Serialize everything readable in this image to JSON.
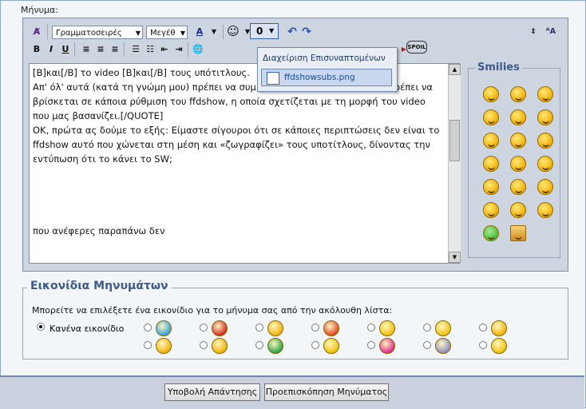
{
  "message_label": "Μήνυμα:",
  "toolbar": {
    "font_select": "Γραμματοσειρές",
    "size_select": "Μεγέθ",
    "attach_label": "0"
  },
  "editor_text": [
    "[B]και[/B] το video [B]και[/B] τους υπότιτλους.",
    "Απ' όλ' αυτά (κατά τη γνώμη μου) πρέπει να συμ",
    "πρέπει να",
    "βρίσκεται σε κάποια ρύθμιση του ffdshow, η οποία σχετίζεται με τη μορφή του video",
    "που μας βασανίζει.[/QUOTE]",
    "",
    "ΟΚ, πρώτα ας δούμε το εξής: Είμαστε σίγουροι ότι σε κάποιες περιπτώσεις δεν είναι το",
    "ffdshow αυτό που χώνεται στη μέση και «ζωγραφίζει» τους υποτίτλους, δίνοντας την",
    "εντύπωση ότι το κάνει το SW;",
    "που ανέφερες παραπάνω δεν"
  ],
  "attachments_popup": {
    "header": "Διαχείριση Επισυναπτομένων",
    "file": "ffdshowsubs.png"
  },
  "smilies_title": "Smilies",
  "smilies_count": 20,
  "icons": {
    "title": "Εικονίδια Μηνυμάτων",
    "description": "Μπορείτε να επιλέξετε ένα εικονίδιο για το μήνυμα σας από την ακόλουθη λίστα:",
    "none_label": "Κανένα εικονίδιο"
  },
  "buttons": {
    "submit": "Υποβολή Απάντησης",
    "preview": "Προεπισκόπηση Μηνύματος"
  },
  "colors": {
    "accent": "#3d5a8a",
    "panel": "#cdd6e0"
  }
}
